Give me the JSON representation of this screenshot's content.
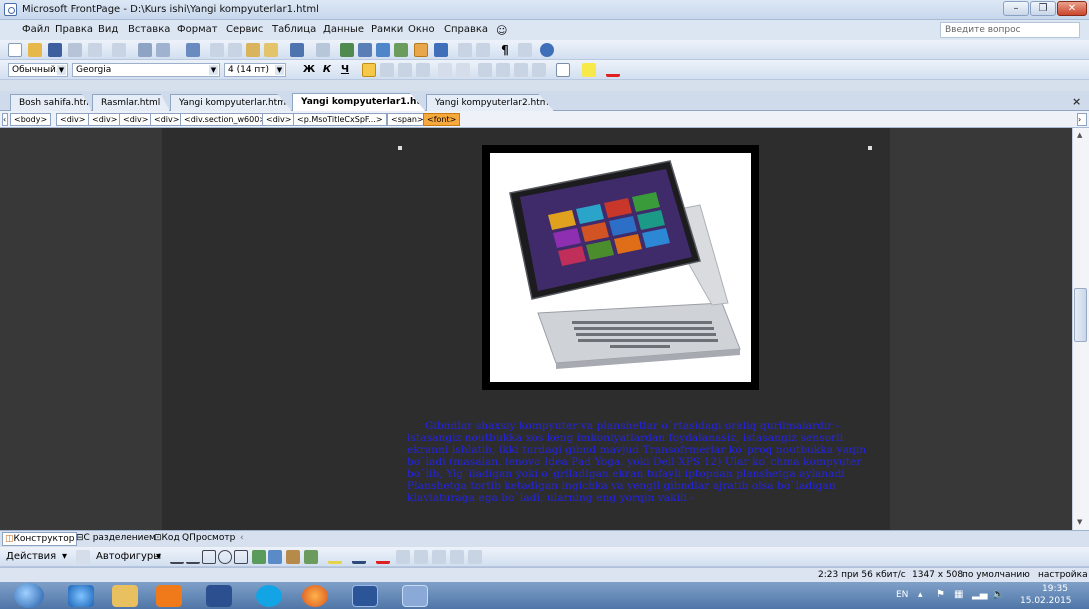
{
  "window": {
    "title": "Microsoft FrontPage - D:\\Kurs ishi\\Yangi kompyuterlar1.html",
    "min_label": "–",
    "max_label": "❐",
    "close_label": "✕"
  },
  "menu": {
    "items": [
      "Файл",
      "Правка",
      "Вид",
      "Вставка",
      "Формат",
      "Сервис",
      "Таблица",
      "Данные",
      "Рамки",
      "Окно",
      "Справка"
    ],
    "ask_placeholder": "Введите вопрос"
  },
  "formatting": {
    "style": "Обычный.Msc",
    "font": "Georgia",
    "size": "4 (14 пт)",
    "bold": "Ж",
    "italic": "К",
    "underline": "Ч"
  },
  "tabs": [
    {
      "label": "Bosh sahifa.htm",
      "active": false
    },
    {
      "label": "Rasmlar.html",
      "active": false
    },
    {
      "label": "Yangi kompyuterlar.html",
      "active": false
    },
    {
      "label": "Yangi kompyuterlar1.html",
      "active": true
    },
    {
      "label": "Yangi kompyuterlar2.html",
      "active": false
    }
  ],
  "tab_close": "×",
  "quicktags": [
    "<body>",
    "<div>",
    "<div>",
    "<div>",
    "<div>",
    "<div.section_w600>",
    "<div>",
    "<p.MsoTitleCxSpF...>",
    "<span>",
    "<font>"
  ],
  "content": {
    "paragraph": "Gibndlar shaxsiy kompyuter va planshetlar o`rtasidagi oraliq qurilmalardir - istasangiz noutbukka xos keng imkoniyatlardan foydalanasiz, istasangiz sensorli ekranni ishlatib, ikki turdagi gibnd mavjud Transofrmerlar ko`proq noutbukka yaqin bo`ladi (masalan, lenovo Idea Pad Yoga, yoki Dell XPS 12) Ular ko`chma kompyuter bo`lib, Yig`iladigan yoki o`griladigan ekran tufayli iptopdan planshetga aylanadi Planshetga tortib ketadigan ingichka va yengil gibndlar ajratib olsa bo`ladigan klaviaturaga ega bo`ladi, ularning eng yorqin vakili -"
  },
  "view_tabs": [
    {
      "label": "Конструктор",
      "active": true
    },
    {
      "label": "С разделением",
      "active": false
    },
    {
      "label": "Код",
      "active": false
    },
    {
      "label": "Просмотр",
      "active": false
    }
  ],
  "drawing": {
    "actions": "Действия",
    "autoshapes": "Автофигуры"
  },
  "status": {
    "speed": "2:23 при 56 кбит/с",
    "size": "1347 x 508",
    "mode": "по умолчанию",
    "settings": "настройка"
  },
  "tray": {
    "lang": "EN",
    "time": "19:35",
    "date": "15.02.2015"
  },
  "colors": {
    "body_text": "#2323e6",
    "canvas": "#383838",
    "page": "#2d2d2d",
    "active_tag": "#f6a83c"
  }
}
